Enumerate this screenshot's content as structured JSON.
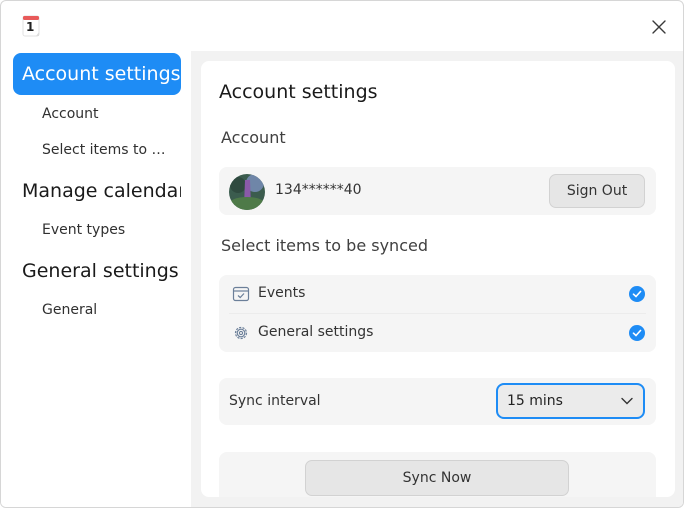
{
  "window": {
    "app_icon": "calendar-app-icon",
    "app_icon_text": "1",
    "close_icon": "close-icon"
  },
  "sidebar": {
    "groups": [
      {
        "label": "Account settings",
        "active": true,
        "items": [
          "Account",
          "Select items to be synced"
        ]
      },
      {
        "label": "Manage calendar",
        "active": false,
        "items": [
          "Event types"
        ]
      },
      {
        "label": "General settings",
        "active": false,
        "items": [
          "General"
        ]
      }
    ]
  },
  "main": {
    "title": "Account settings",
    "account": {
      "heading": "Account",
      "username": "134******40",
      "sign_out_label": "Sign Out"
    },
    "sync_items": {
      "heading": "Select items to be synced",
      "items": [
        {
          "label": "Events",
          "icon": "calendar-event-icon",
          "checked": true
        },
        {
          "label": "General settings",
          "icon": "gear-icon",
          "checked": true
        }
      ]
    },
    "sync_interval": {
      "label": "Sync interval",
      "value": "15 mins"
    },
    "sync_now_label": "Sync Now"
  },
  "colors": {
    "accent": "#1e8cf5",
    "panel_bg": "#f2f2f2",
    "card_bg": "#f5f5f5"
  }
}
